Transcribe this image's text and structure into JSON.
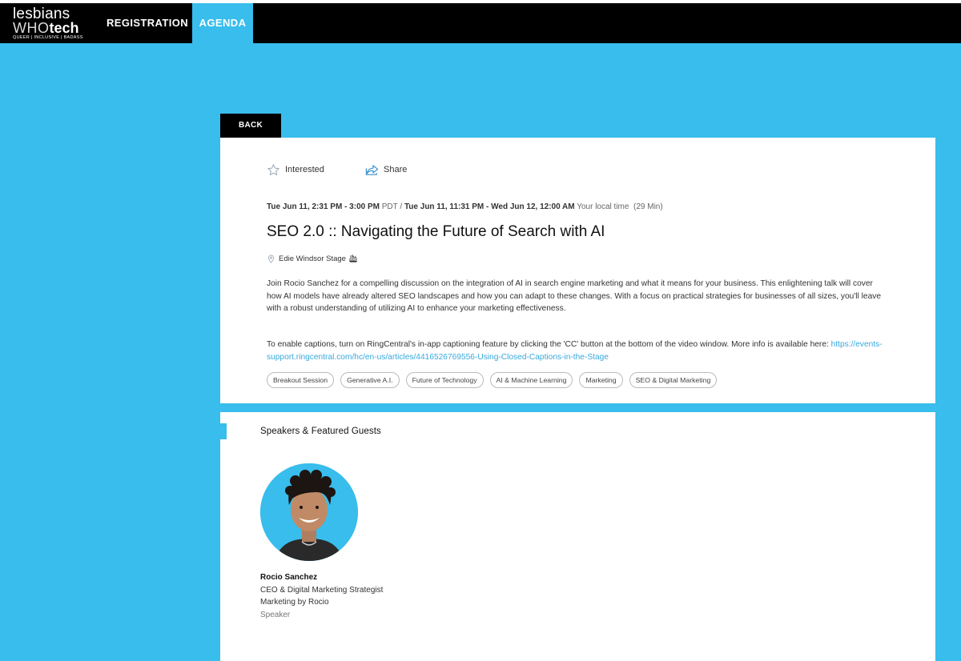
{
  "logo": {
    "line1": "lesbians",
    "who": "WHO",
    "tech": "tech",
    "tagline": "QUEER | INCLUSIVE | BADASS"
  },
  "nav": {
    "items": [
      {
        "label": "REGISTRATION"
      },
      {
        "label": "AGENDA"
      }
    ]
  },
  "back_label": "BACK",
  "actions": {
    "interested": "Interested",
    "share": "Share"
  },
  "session": {
    "time_pdt": "Tue Jun 11, 2:31 PM - 3:00 PM",
    "pdt_label": "PDT /",
    "time_local": "Tue Jun 11, 11:31 PM - Wed Jun 12, 12:00 AM",
    "local_label": "Your local time",
    "duration": "(29 Min)",
    "title": "SEO 2.0 :: Navigating the Future of Search with AI",
    "location": "Edie Windsor Stage 🛳",
    "description": "Join Rocio Sanchez for a compelling discussion on the integration of AI in search engine marketing and what it means for your business. This enlightening talk will cover how AI models have already altered SEO landscapes and how you can adapt to these changes. With a focus on practical strategies for businesses of all sizes, you'll leave with a robust understanding of utilizing AI to enhance your marketing effectiveness.",
    "captions_text": "To enable captions, turn on RingCentral's in-app captioning feature by clicking the 'CC' button at the bottom of the video window. More info is available here: ",
    "captions_link": "https://events-support.ringcentral.com/hc/en-us/articles/4416526769556-Using-Closed-Captions-in-the-Stage",
    "tags": [
      "Breakout Session",
      "Generative A.I.",
      "Future of Technology",
      "AI & Machine Learning",
      "Marketing",
      "SEO & Digital Marketing"
    ]
  },
  "speakers": {
    "section_title": "Speakers & Featured Guests",
    "items": [
      {
        "name": "Rocio Sanchez",
        "title": "CEO & Digital Marketing Strategist",
        "company": "Marketing by Rocio",
        "role": "Speaker"
      }
    ]
  },
  "colors": {
    "accent": "#38bdec",
    "nav_bg": "#000000",
    "link": "#38a9dc"
  }
}
